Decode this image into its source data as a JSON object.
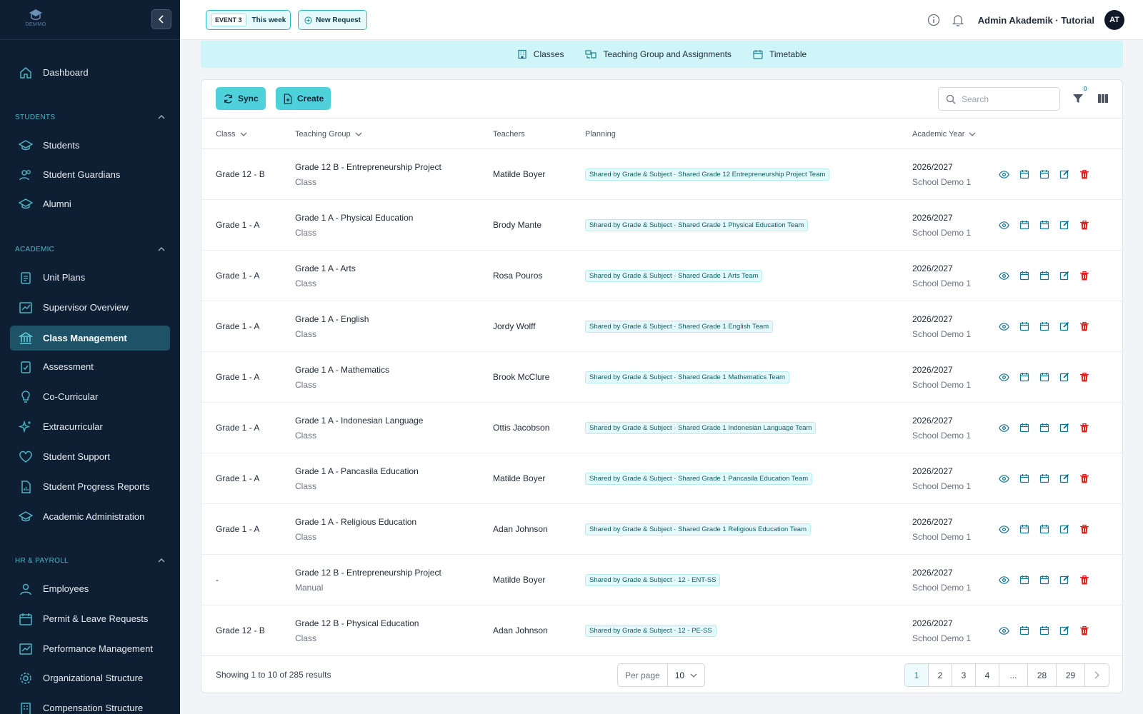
{
  "sidebar": {
    "logo_text": "DEMMO",
    "sections": {
      "students": "STUDENTS",
      "academic": "ACADEMIC",
      "hr": "HR & PAYROLL"
    },
    "items": {
      "dashboard": "Dashboard",
      "students": "Students",
      "guardians": "Student Guardians",
      "alumni": "Alumni",
      "unit_plans": "Unit Plans",
      "supervisor": "Supervisor Overview",
      "class_mgmt": "Class Management",
      "assessment": "Assessment",
      "cocurricular": "Co-Curricular",
      "extracurricular": "Extracurricular",
      "support": "Student Support",
      "progress": "Student Progress Reports",
      "academic_admin": "Academic Administration",
      "employees": "Employees",
      "permit": "Permit & Leave Requests",
      "performance": "Performance Management",
      "org": "Organizational Structure",
      "compensation": "Compensation Structure"
    }
  },
  "topbar": {
    "event_tag": "EVENT 3",
    "event_label": "This week",
    "new_request": "New Request",
    "user_name": "Admin Akademik · Tutorial",
    "avatar_initials": "AT"
  },
  "subtabs": {
    "classes": "Classes",
    "teaching": "Teaching Group and Assignments",
    "timetable": "Timetable"
  },
  "toolbar": {
    "sync": "Sync",
    "create": "Create",
    "search_placeholder": "Search",
    "filter_count": "0"
  },
  "table": {
    "headers": {
      "class": "Class",
      "teaching_group": "Teaching Group",
      "teachers": "Teachers",
      "planning": "Planning",
      "academic_year": "Academic Year"
    },
    "rows": [
      {
        "class": "Grade 12 - B",
        "group": "Grade 12 B - Entrepreneurship Project",
        "type": "Class",
        "teacher": "Matilde Boyer",
        "planning": "Shared by Grade & Subject · Shared Grade 12 Entrepreneurship Project Team",
        "year": "2026/2027",
        "school": "School Demo 1"
      },
      {
        "class": "Grade 1 - A",
        "group": "Grade 1 A - Physical Education",
        "type": "Class",
        "teacher": "Brody Mante",
        "planning": "Shared by Grade & Subject · Shared Grade 1 Physical Education Team",
        "year": "2026/2027",
        "school": "School Demo 1"
      },
      {
        "class": "Grade 1 - A",
        "group": "Grade 1 A - Arts",
        "type": "Class",
        "teacher": "Rosa Pouros",
        "planning": "Shared by Grade & Subject · Shared Grade 1 Arts Team",
        "year": "2026/2027",
        "school": "School Demo 1"
      },
      {
        "class": "Grade 1 - A",
        "group": "Grade 1 A - English",
        "type": "Class",
        "teacher": "Jordy Wolff",
        "planning": "Shared by Grade & Subject · Shared Grade 1 English Team",
        "year": "2026/2027",
        "school": "School Demo 1"
      },
      {
        "class": "Grade 1 - A",
        "group": "Grade 1 A - Mathematics",
        "type": "Class",
        "teacher": "Brook McClure",
        "planning": "Shared by Grade & Subject · Shared Grade 1 Mathematics Team",
        "year": "2026/2027",
        "school": "School Demo 1"
      },
      {
        "class": "Grade 1 - A",
        "group": "Grade 1 A - Indonesian Language",
        "type": "Class",
        "teacher": "Ottis Jacobson",
        "planning": "Shared by Grade & Subject · Shared Grade 1 Indonesian Language Team",
        "year": "2026/2027",
        "school": "School Demo 1"
      },
      {
        "class": "Grade 1 - A",
        "group": "Grade 1 A - Pancasila Education",
        "type": "Class",
        "teacher": "Matilde Boyer",
        "planning": "Shared by Grade & Subject · Shared Grade 1 Pancasila Education Team",
        "year": "2026/2027",
        "school": "School Demo 1"
      },
      {
        "class": "Grade 1 - A",
        "group": "Grade 1 A - Religious Education",
        "type": "Class",
        "teacher": "Adan Johnson",
        "planning": "Shared by Grade & Subject · Shared Grade 1 Religious Education Team",
        "year": "2026/2027",
        "school": "School Demo 1"
      },
      {
        "class": "-",
        "group": "Grade 12 B - Entrepreneurship Project",
        "type": "Manual",
        "teacher": "Matilde Boyer",
        "planning": "Shared by Grade & Subject · 12 - ENT-SS",
        "year": "2026/2027",
        "school": "School Demo 1"
      },
      {
        "class": "Grade 12 - B",
        "group": "Grade 12 B - Physical Education",
        "type": "Class",
        "teacher": "Adan Johnson",
        "planning": "Shared by Grade & Subject · 12 - PE-SS",
        "year": "2026/2027",
        "school": "School Demo 1"
      }
    ]
  },
  "footer": {
    "showing": "Showing 1 to 10 of 285 results",
    "per_page_label": "Per page",
    "per_page_value": "10",
    "pages": [
      "1",
      "2",
      "3",
      "4",
      "...",
      "28",
      "29"
    ]
  },
  "colors": {
    "sidebar_bg": "#0f1f33",
    "accent": "#4fd1dc",
    "active_item": "#1e5367",
    "delete": "#dc2626",
    "edit": "#0e7490"
  }
}
